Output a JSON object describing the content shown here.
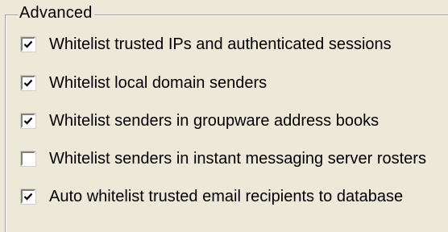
{
  "group": {
    "title": "Advanced"
  },
  "options": [
    {
      "label": "Whitelist trusted IPs and authenticated sessions",
      "checked": true
    },
    {
      "label": "Whitelist local domain senders",
      "checked": true
    },
    {
      "label": "Whitelist senders in groupware address books",
      "checked": true
    },
    {
      "label": "Whitelist senders in instant messaging server rosters",
      "checked": false
    },
    {
      "label": "Auto whitelist trusted email recipients to database",
      "checked": true
    }
  ]
}
